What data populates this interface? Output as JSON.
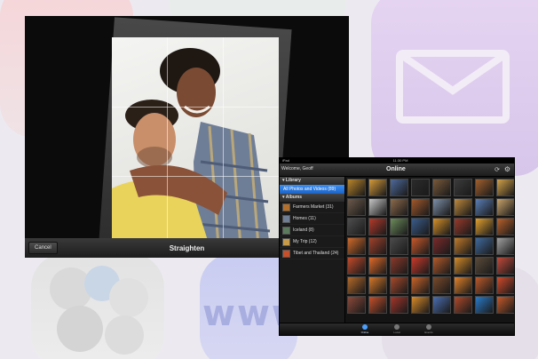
{
  "straighten": {
    "cancel_label": "Cancel",
    "title": "Straighten"
  },
  "gallery": {
    "status_left": "iPad",
    "status_time": "11:30 PM",
    "status_right": "",
    "user_label": "Welcome, Geoff",
    "title": "Online",
    "refresh_icon": "refresh-icon",
    "gear_icon": "gear-icon",
    "library_header": "Library",
    "library_item": "All Photos and Videos (89)",
    "albums_header": "Albums",
    "albums": [
      {
        "label": "Farmers Market (31)",
        "color": "#b4702a"
      },
      {
        "label": "Homes (11)",
        "color": "#6f7e94"
      },
      {
        "label": "Iceland (8)",
        "color": "#5e7a5e"
      },
      {
        "label": "My Trip (12)",
        "color": "#c79a4a"
      },
      {
        "label": "Tibet and Thailand (24)",
        "color": "#c74f2a"
      }
    ],
    "thumb_colors": [
      "#b8852c",
      "#d49b3b",
      "#4e6a9a",
      "#2b2b2b",
      "#7a5a3a",
      "#3b3b3b",
      "#a0602c",
      "#d2a24a",
      "#6d5a4b",
      "#c7c7c7",
      "#8d6b4b",
      "#a25a2b",
      "#7d8fa8",
      "#bf8a3c",
      "#5a7fb5",
      "#c9a46a",
      "#4e4e4e",
      "#b53a2a",
      "#6c8b5a",
      "#3a5c8a",
      "#d4902a",
      "#9a3a2a",
      "#e0a030",
      "#b8612a",
      "#d06a2a",
      "#a0412a",
      "#4b4b4b",
      "#c7582a",
      "#7a2a2a",
      "#bf7a2a",
      "#3f6a9a",
      "#a0a0a0",
      "#c24a2a",
      "#e06a2a",
      "#8a3a2a",
      "#c73a2a",
      "#b25a2a",
      "#d28a2a",
      "#5a4a3a",
      "#c14a3a",
      "#b46a2a",
      "#d6782a",
      "#a84a2a",
      "#c8642a",
      "#7a4a2a",
      "#e2822a",
      "#bb5a2a",
      "#d24a2a",
      "#8a4a3a",
      "#c7502a",
      "#a6362a",
      "#d88a2a",
      "#4a6fb0",
      "#b04a2a",
      "#2a7ac8",
      "#c55a2a"
    ],
    "tabs": [
      {
        "label": "Online",
        "active": true
      },
      {
        "label": "Local",
        "active": false
      },
      {
        "label": "Events",
        "active": false
      }
    ]
  }
}
